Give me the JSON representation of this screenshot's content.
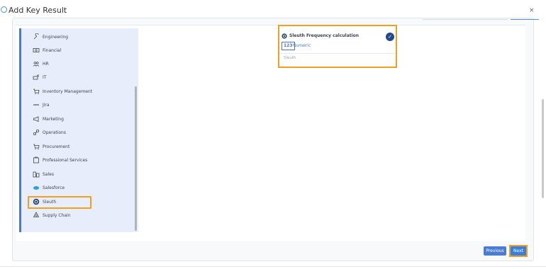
{
  "window": {
    "title": "Add Key Result",
    "close_label": "×"
  },
  "sidebar": {
    "items": [
      {
        "label": "Engineering",
        "icon": "wrench-icon"
      },
      {
        "label": "Financial",
        "icon": "money-icon"
      },
      {
        "label": "HR",
        "icon": "people-icon"
      },
      {
        "label": "IT",
        "icon": "it-icon"
      },
      {
        "label": "Inventory Management",
        "icon": "cart-icon"
      },
      {
        "label": "Jira",
        "icon": "jira-icon"
      },
      {
        "label": "Marketing",
        "icon": "megaphone-icon"
      },
      {
        "label": "Operations",
        "icon": "operations-icon"
      },
      {
        "label": "Procurement",
        "icon": "cart-icon"
      },
      {
        "label": "Professional Services",
        "icon": "briefcase-icon"
      },
      {
        "label": "Sales",
        "icon": "sales-chart-icon"
      },
      {
        "label": "Salesforce",
        "icon": "salesforce-cloud-icon"
      },
      {
        "label": "Sleuth",
        "icon": "sleuth-icon"
      },
      {
        "label": "Supply Chain",
        "icon": "recycle-icon"
      }
    ],
    "selected": "Sleuth"
  },
  "key_result_card": {
    "title": "Sleuth Frequency calculation",
    "numeric_badge": "123",
    "type": "Numeric",
    "source": "Sleuth",
    "selected": true
  },
  "footer": {
    "previous_label": "Previous",
    "next_label": "Next"
  },
  "colors": {
    "accent": "#3a7fe0",
    "highlight": "#f0a020",
    "check": "#1f4a8e",
    "sidebar_bg": "#e8edfb"
  }
}
